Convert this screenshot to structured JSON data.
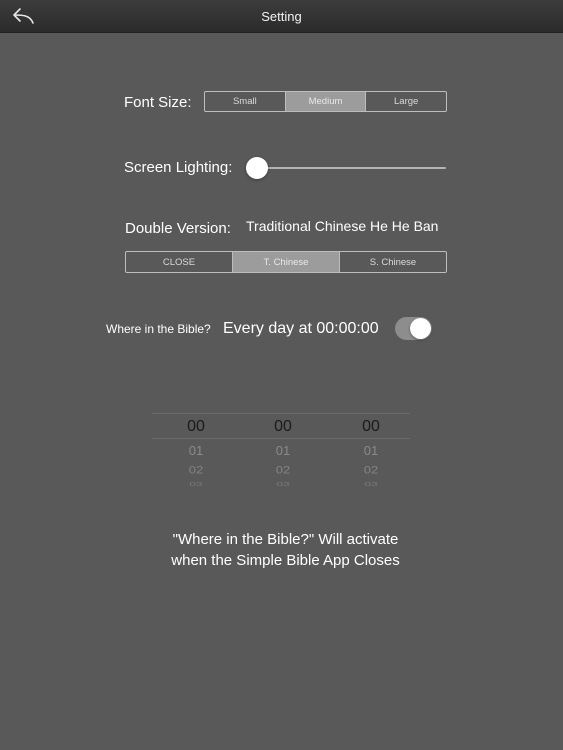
{
  "nav": {
    "title": "Setting",
    "back_icon": "back-arrow-icon"
  },
  "font_size": {
    "label": "Font Size:",
    "options": [
      "Small",
      "Medium",
      "Large"
    ],
    "selected": "Medium"
  },
  "screen_lighting": {
    "label": "Screen Lighting:",
    "value": 0.05
  },
  "double_version": {
    "label": "Double Version:",
    "current_value": "Traditional Chinese He He Ban",
    "options": [
      "CLOSE",
      "T. Chinese",
      "S. Chinese"
    ],
    "selected": "T. Chinese"
  },
  "reminder": {
    "label": "Where in the Bible?",
    "schedule": "Every day at 00:00:00",
    "enabled": true
  },
  "time_picker": {
    "columns": [
      {
        "values": [
          "00",
          "01",
          "02",
          "03"
        ]
      },
      {
        "values": [
          "00",
          "01",
          "02",
          "03"
        ]
      },
      {
        "values": [
          "00",
          "01",
          "02",
          "03"
        ]
      }
    ]
  },
  "footer": {
    "line1": "\"Where in the Bible?\" Will activate",
    "line2": "when the Simple Bible App Closes"
  },
  "colors": {
    "background": "#595959",
    "navbar": "#2b2b2b",
    "selected_segment": "#9c9c9c",
    "toggle_on": "#8d8d8d"
  }
}
